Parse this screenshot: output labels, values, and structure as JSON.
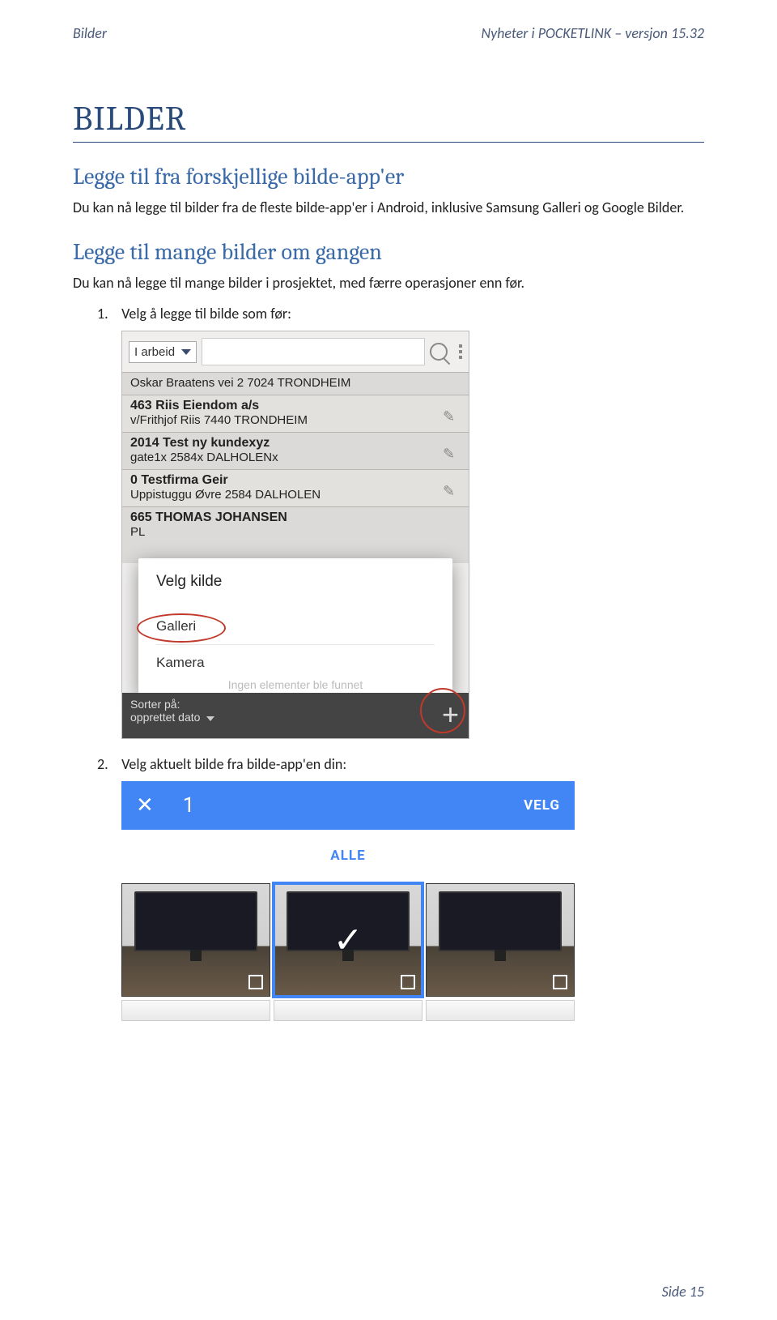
{
  "header": {
    "left": "Bilder",
    "right": "Nyheter i POCKETLINK – versjon 15.32"
  },
  "heading": "BILDER",
  "section1": {
    "title": "Legge til fra forskjellige bilde-app'er",
    "body": "Du kan nå legge til bilder fra de fleste bilde-app'er i Android, inklusive Samsung Galleri og Google Bilder."
  },
  "section2": {
    "title": "Legge til mange bilder om gangen",
    "body": "Du kan nå legge til mange bilder i prosjektet, med færre operasjoner enn før."
  },
  "step1": {
    "num": "1.",
    "text": "Velg å legge til bilde som før:"
  },
  "shot1": {
    "filter": "I arbeid",
    "rows": [
      {
        "l1": "Oskar Braatens vei 2   7024   TRONDHEIM"
      },
      {
        "l1": "463   Riis Eiendom a/s",
        "l2": "v/Frithjof Riis   7440   TRONDHEIM"
      },
      {
        "l1": "2014   Test ny kundexyz",
        "l2": "gate1x   2584x   DALHOLENx"
      },
      {
        "l1": "0   Testfirma Geir",
        "l2": "Uppistuggu Øvre   2584   DALHOLEN"
      },
      {
        "l1": "665   THOMAS JOHANSEN",
        "l2": "PL"
      }
    ],
    "dialog": {
      "title": "Velg kilde",
      "opt1": "Galleri",
      "opt2": "Kamera"
    },
    "ghost": "Ingen elementer ble funnet",
    "sort_label": "Sorter på:",
    "sort_value": "opprettet dato"
  },
  "step2": {
    "num": "2.",
    "text": "Velg aktuelt bilde fra bilde-app'en din:"
  },
  "shot2": {
    "count": "1",
    "action": "VELG",
    "tab": "ALLE"
  },
  "footer": "Side 15"
}
